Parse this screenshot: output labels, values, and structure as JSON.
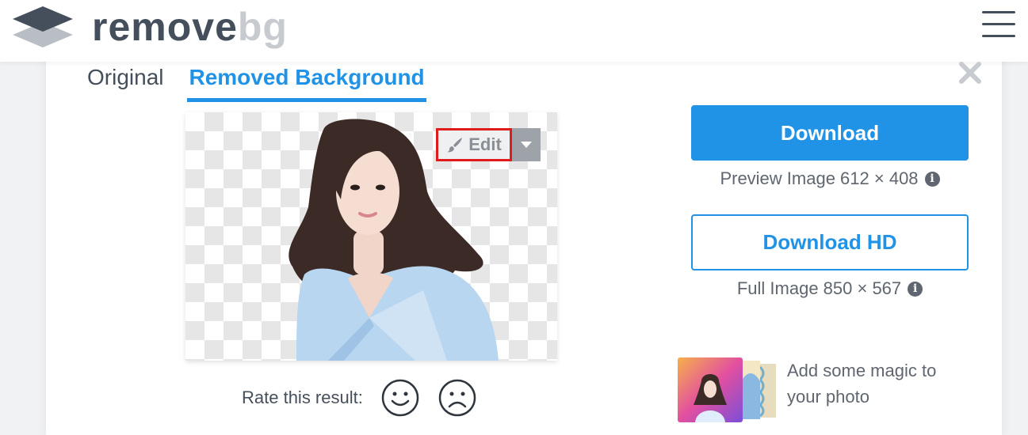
{
  "header": {
    "logo_word1": "remove",
    "logo_word2": "bg",
    "menu_icon": "hamburger-menu-icon"
  },
  "tabs": [
    {
      "label": "Original",
      "active": false
    },
    {
      "label": "Removed Background",
      "active": true
    }
  ],
  "preview": {
    "edit_label": "Edit",
    "edit_icon": "paintbrush-icon",
    "dropdown_icon": "caret-down-icon"
  },
  "rating": {
    "label": "Rate this result:",
    "positive_icon": "smile-face-icon",
    "negative_icon": "frown-face-icon"
  },
  "download": {
    "label": "Download",
    "info": "Preview Image 612 × 408"
  },
  "download_hd": {
    "label": "Download HD",
    "info": "Full Image 850 × 567"
  },
  "magic": {
    "line1": "Add some magic to",
    "line2": "your photo"
  },
  "colors": {
    "accent": "#2193e6",
    "highlight": "#e01b1b",
    "text": "#454f5b"
  }
}
